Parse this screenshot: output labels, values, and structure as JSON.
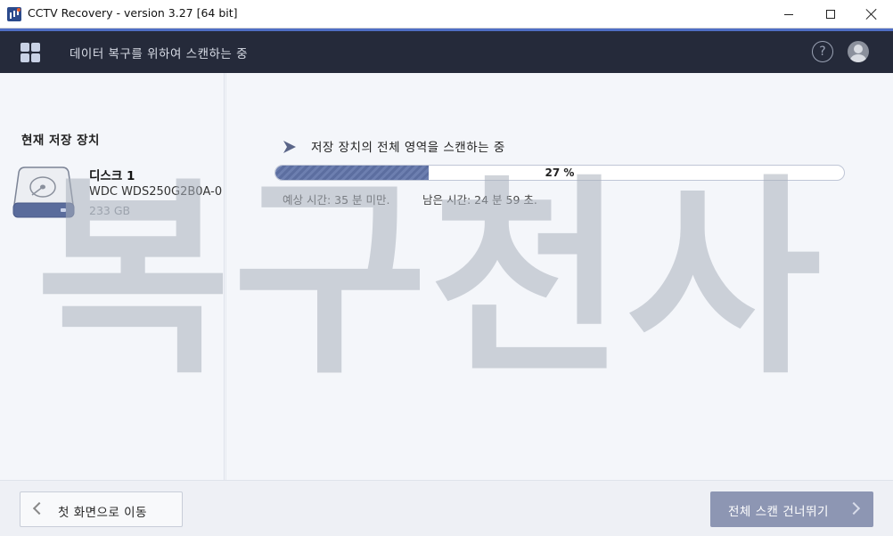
{
  "window": {
    "title": "CCTV Recovery - version 3.27 [64 bit]",
    "app_icon": "app-logo-icon",
    "minimize_icon": "minimize-icon",
    "maximize_icon": "maximize-icon",
    "close_icon": "close-icon"
  },
  "header": {
    "title": "데이터 복구를 위하여 스캔하는 중",
    "menu_icon": "grid-menu-icon",
    "help_label": "?",
    "user_icon": "user-avatar-icon"
  },
  "left_panel": {
    "heading": "현재 저장 장치",
    "disk": {
      "icon": "hard-disk-icon",
      "name": "디스크 1",
      "model": "WDC   WDS250G2B0A-0...",
      "size": "233 GB"
    }
  },
  "scan": {
    "title": "저장 장치의 전체 영역을 스캔하는 중",
    "progress_fraction": 0.27,
    "progress_text": "27 %",
    "estimated_time": "예상 시간:  35 분 미만.",
    "remaining_time": "남은 시간:  24 분  59 초."
  },
  "watermark": {
    "text": "복구천사"
  },
  "footer": {
    "back_label": "첫 화면으로 이동",
    "skip_label": "전체 스캔 건너뛰기"
  },
  "colors": {
    "header_bg": "#252a3a",
    "accent": "#4f6ec5",
    "progress_fill": "#5c6ea0",
    "skip_button": "#8d96b3"
  }
}
